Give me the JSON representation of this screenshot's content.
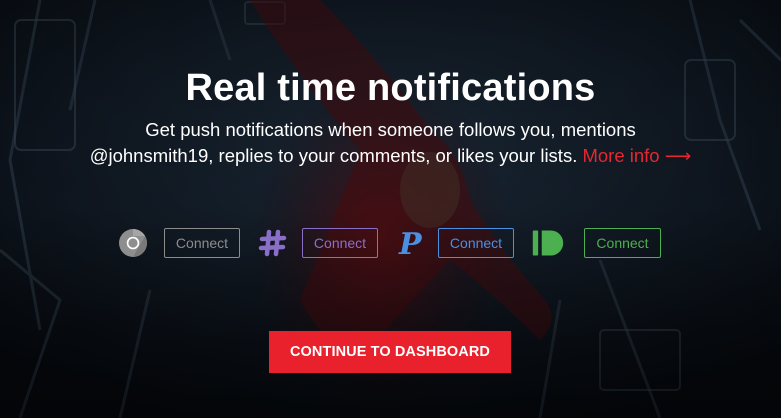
{
  "hero": {
    "title": "Real time notifications",
    "subtitle_line1": "Get push notifications when someone follows you, mentions",
    "subtitle_line2": "@johnsmith19, replies to your comments, or likes your lists.",
    "more_info_label": "More info",
    "more_info_arrow": "⟶"
  },
  "services": [
    {
      "icon": "chrome-icon",
      "connect_label": "Connect",
      "color": "#8c8c8c"
    },
    {
      "icon": "slack-hash-icon",
      "connect_label": "Connect",
      "color": "#8a6fc9"
    },
    {
      "icon": "pushbullet-p-icon",
      "connect_label": "Connect",
      "color": "#4a90e2"
    },
    {
      "icon": "pushbullet-icon",
      "connect_label": "Connect",
      "color": "#4caf50"
    }
  ],
  "cta": {
    "label": "CONTINUE TO DASHBOARD",
    "color": "#e8212c"
  },
  "colors": {
    "accent": "#e8262f",
    "background": "#0c1119",
    "text": "#ffffff"
  }
}
